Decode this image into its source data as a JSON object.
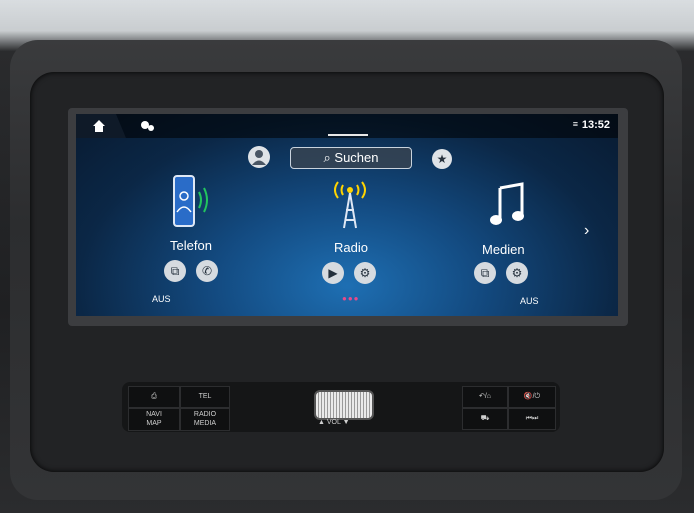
{
  "status": {
    "time": "13:52"
  },
  "search": {
    "label": "Suchen"
  },
  "tiles": [
    {
      "label": "Telefon",
      "status": "AUS"
    },
    {
      "label": "Radio",
      "status": ""
    },
    {
      "label": "Medien",
      "status": "AUS"
    }
  ],
  "console": {
    "tel": "TEL",
    "navi": "NAVI\nMAP",
    "radio_media": "RADIO\nMEDIA",
    "vol": "VOL",
    "vol_down": "▲",
    "vol_up": "▼"
  },
  "colors": {
    "accent": "#ffd400",
    "phone_accent": "#22c55e",
    "page_dots": "#e94a8a"
  }
}
